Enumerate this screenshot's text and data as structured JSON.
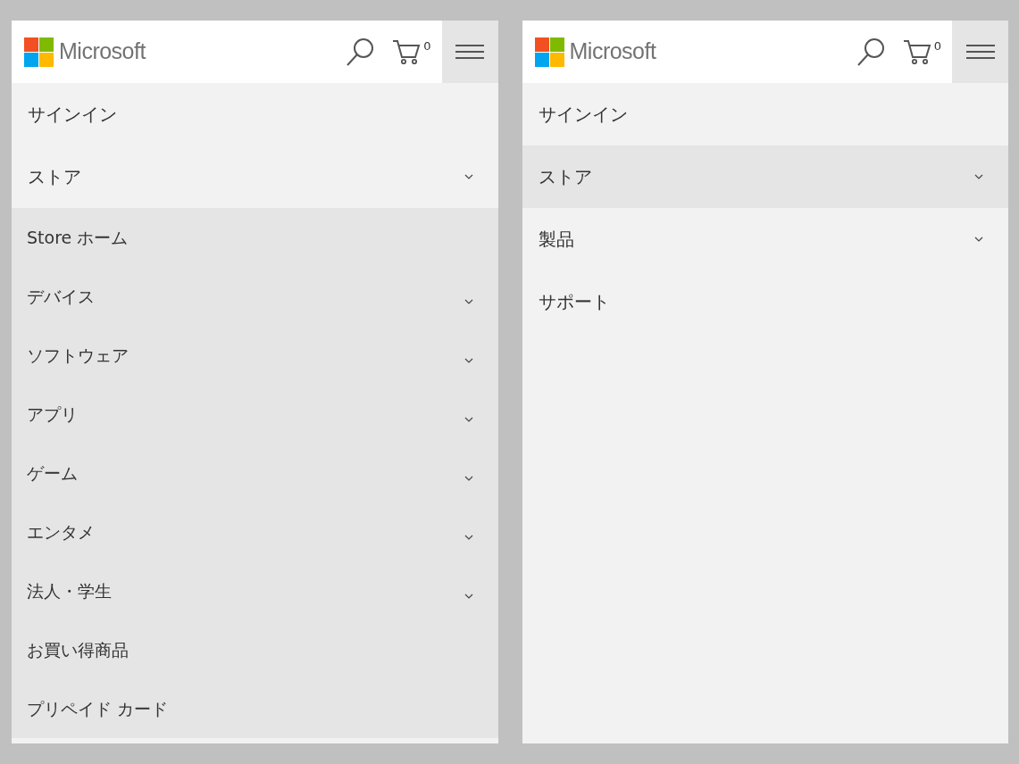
{
  "panels": [
    {
      "logo_text": "Microsoft",
      "cart_count": "0",
      "menu": [
        {
          "label": "サインイン",
          "kind": "link",
          "selected": false
        },
        {
          "label": "ストア",
          "kind": "expandable",
          "selected": false,
          "expanded": true,
          "children": [
            {
              "label": "Store ホーム",
              "kind": "link"
            },
            {
              "label": "デバイス",
              "kind": "expandable",
              "expanded": false
            },
            {
              "label": "ソフトウェア",
              "kind": "expandable",
              "expanded": false
            },
            {
              "label": "アプリ",
              "kind": "expandable",
              "expanded": false
            },
            {
              "label": "ゲーム",
              "kind": "expandable",
              "expanded": false
            },
            {
              "label": "エンタメ",
              "kind": "expandable",
              "expanded": false
            },
            {
              "label": "法人・学生",
              "kind": "expandable",
              "expanded": false
            },
            {
              "label": "お買い得商品",
              "kind": "link"
            },
            {
              "label": "プリペイド カード",
              "kind": "link"
            }
          ]
        }
      ]
    },
    {
      "logo_text": "Microsoft",
      "cart_count": "0",
      "menu": [
        {
          "label": "サインイン",
          "kind": "link",
          "selected": false
        },
        {
          "label": "ストア",
          "kind": "expandable",
          "selected": true
        },
        {
          "label": "製品",
          "kind": "expandable",
          "selected": false
        },
        {
          "label": "サポート",
          "kind": "link",
          "selected": false
        }
      ]
    }
  ]
}
